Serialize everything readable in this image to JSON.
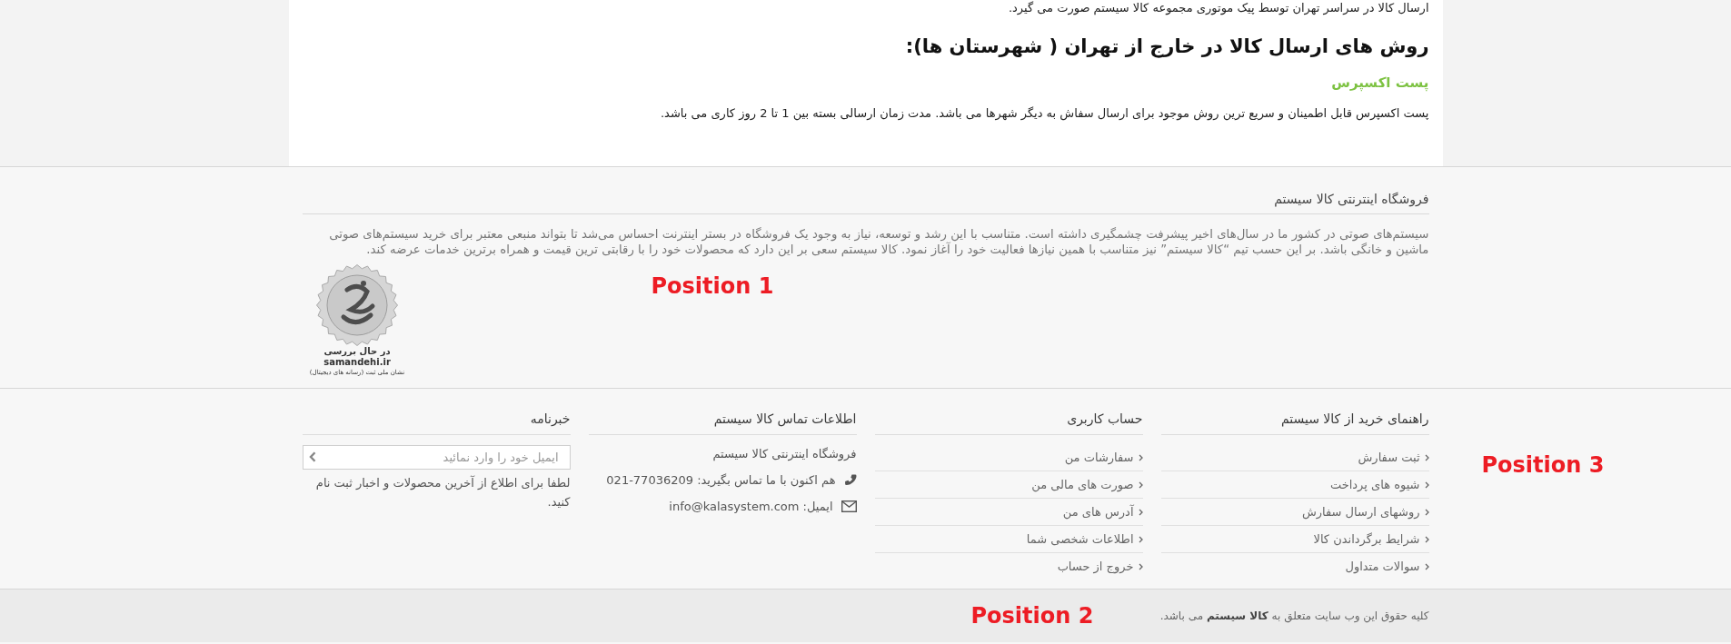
{
  "article": {
    "intro": "ارسال کالا در سراسر تهران توسط پیک موتوری مجموعه کالا سیستم صورت می گیرد.",
    "heading": "روش های ارسال کالا در خارج از تهران ( شهرستان ها):",
    "subheading": "پست اکسپرس",
    "paragraph": "پست اکسپرس قابل اطمینان و سریع ترین روش موجود برای ارسال سفاش به دیگر شهرها می باشد. مدت زمان ارسالی بسته بین 1 تا 2 روز کاری می باشد."
  },
  "about": {
    "title": "فروشگاه اینترنتی کالا سیستم",
    "text": "سیستم‌های صوتی در کشور ما در سال‌های اخیر پیشرفت چشمگیری داشته است. متناسب با این رشد و توسعه، نیاز به وجود یک فروشگاه در بستر اینترنت احساس می‌شد تا بتواند منبعی معتبر برای خرید سیستم‌های صوتی ماشین و خانگی باشد. بر این حسب تیم “کالا سیستم” نیز متناسب با همین نیازها فعالیت خود را آغاز نمود. کالا سیستم سعی بر این دارد که محصولات خود را با رقابتی ترین قیمت و همراه برترین خدمات عرضه کند.",
    "seal": {
      "status": "در حال بررسی",
      "domain": "samandehi.ir",
      "caption": "نشان ملی ثبت (رسانه های دیجیتال)"
    },
    "annotation": "Position 1"
  },
  "footer": {
    "columns": [
      {
        "kind": "links",
        "title": "راهنمای خرید از کالا سیستم",
        "links": [
          "ثبت سفارش",
          "شیوه های پرداخت",
          "روشهای ارسال سفارش",
          "شرایط برگرداندن کالا",
          "سوالات متداول"
        ]
      },
      {
        "kind": "links",
        "title": "حساب کاربری",
        "links": [
          "سفارشات من",
          "صورت های مالی من",
          "آدرس های من",
          "اطلاعات شخصی شما",
          "خروج از حساب"
        ]
      },
      {
        "kind": "contact",
        "title": "اطلاعات تماس کالا سیستم",
        "lines": [
          {
            "kind": "text",
            "text": "فروشگاه اینترنتی کالا سیستم"
          },
          {
            "kind": "phone",
            "text": "هم اکنون با ما تماس بگیرید:",
            "number": "021-77036209"
          },
          {
            "kind": "email",
            "text": "ایمیل: info@kalasystem.com"
          }
        ]
      },
      {
        "kind": "newsletter",
        "title": "خبرنامه",
        "placeholder": "ایمیل خود را وارد نمائید",
        "note": "لطفا برای اطلاع از آخرین محصولات و اخبار ثبت نام کنید."
      }
    ],
    "annotation": "Position 3"
  },
  "copyright": {
    "text": "کلیه حقوق این وب سایت متعلق به **کالا سیستم** می باشد.",
    "annotation": "Position 2"
  }
}
